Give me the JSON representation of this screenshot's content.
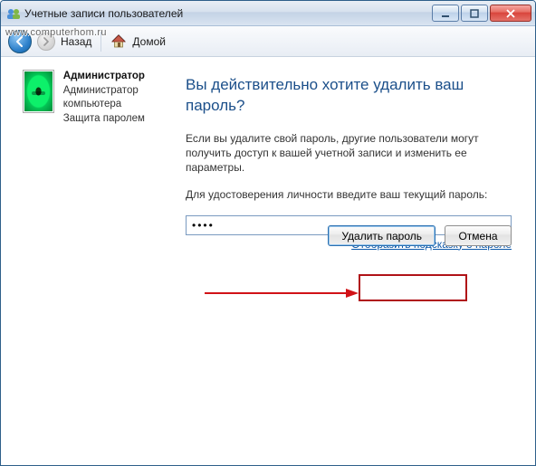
{
  "window": {
    "title": "Учетные записи пользователей"
  },
  "nav": {
    "back_label": "Назад",
    "home_label": "Домой"
  },
  "user": {
    "name": "Администратор",
    "role": "Администратор компьютера",
    "status": "Защита паролем"
  },
  "main": {
    "heading": "Вы действительно хотите удалить ваш пароль?",
    "warning": "Если вы удалите свой пароль, другие пользователи могут получить доступ к вашей учетной записи и изменить ее параметры.",
    "prompt": "Для удостоверения личности введите ваш текущий пароль:",
    "password_value": "••••",
    "hint_link": "Отобразить подсказку о пароле"
  },
  "buttons": {
    "delete": "Удалить пароль",
    "cancel": "Отмена"
  },
  "watermark": "www.computerhom.ru"
}
